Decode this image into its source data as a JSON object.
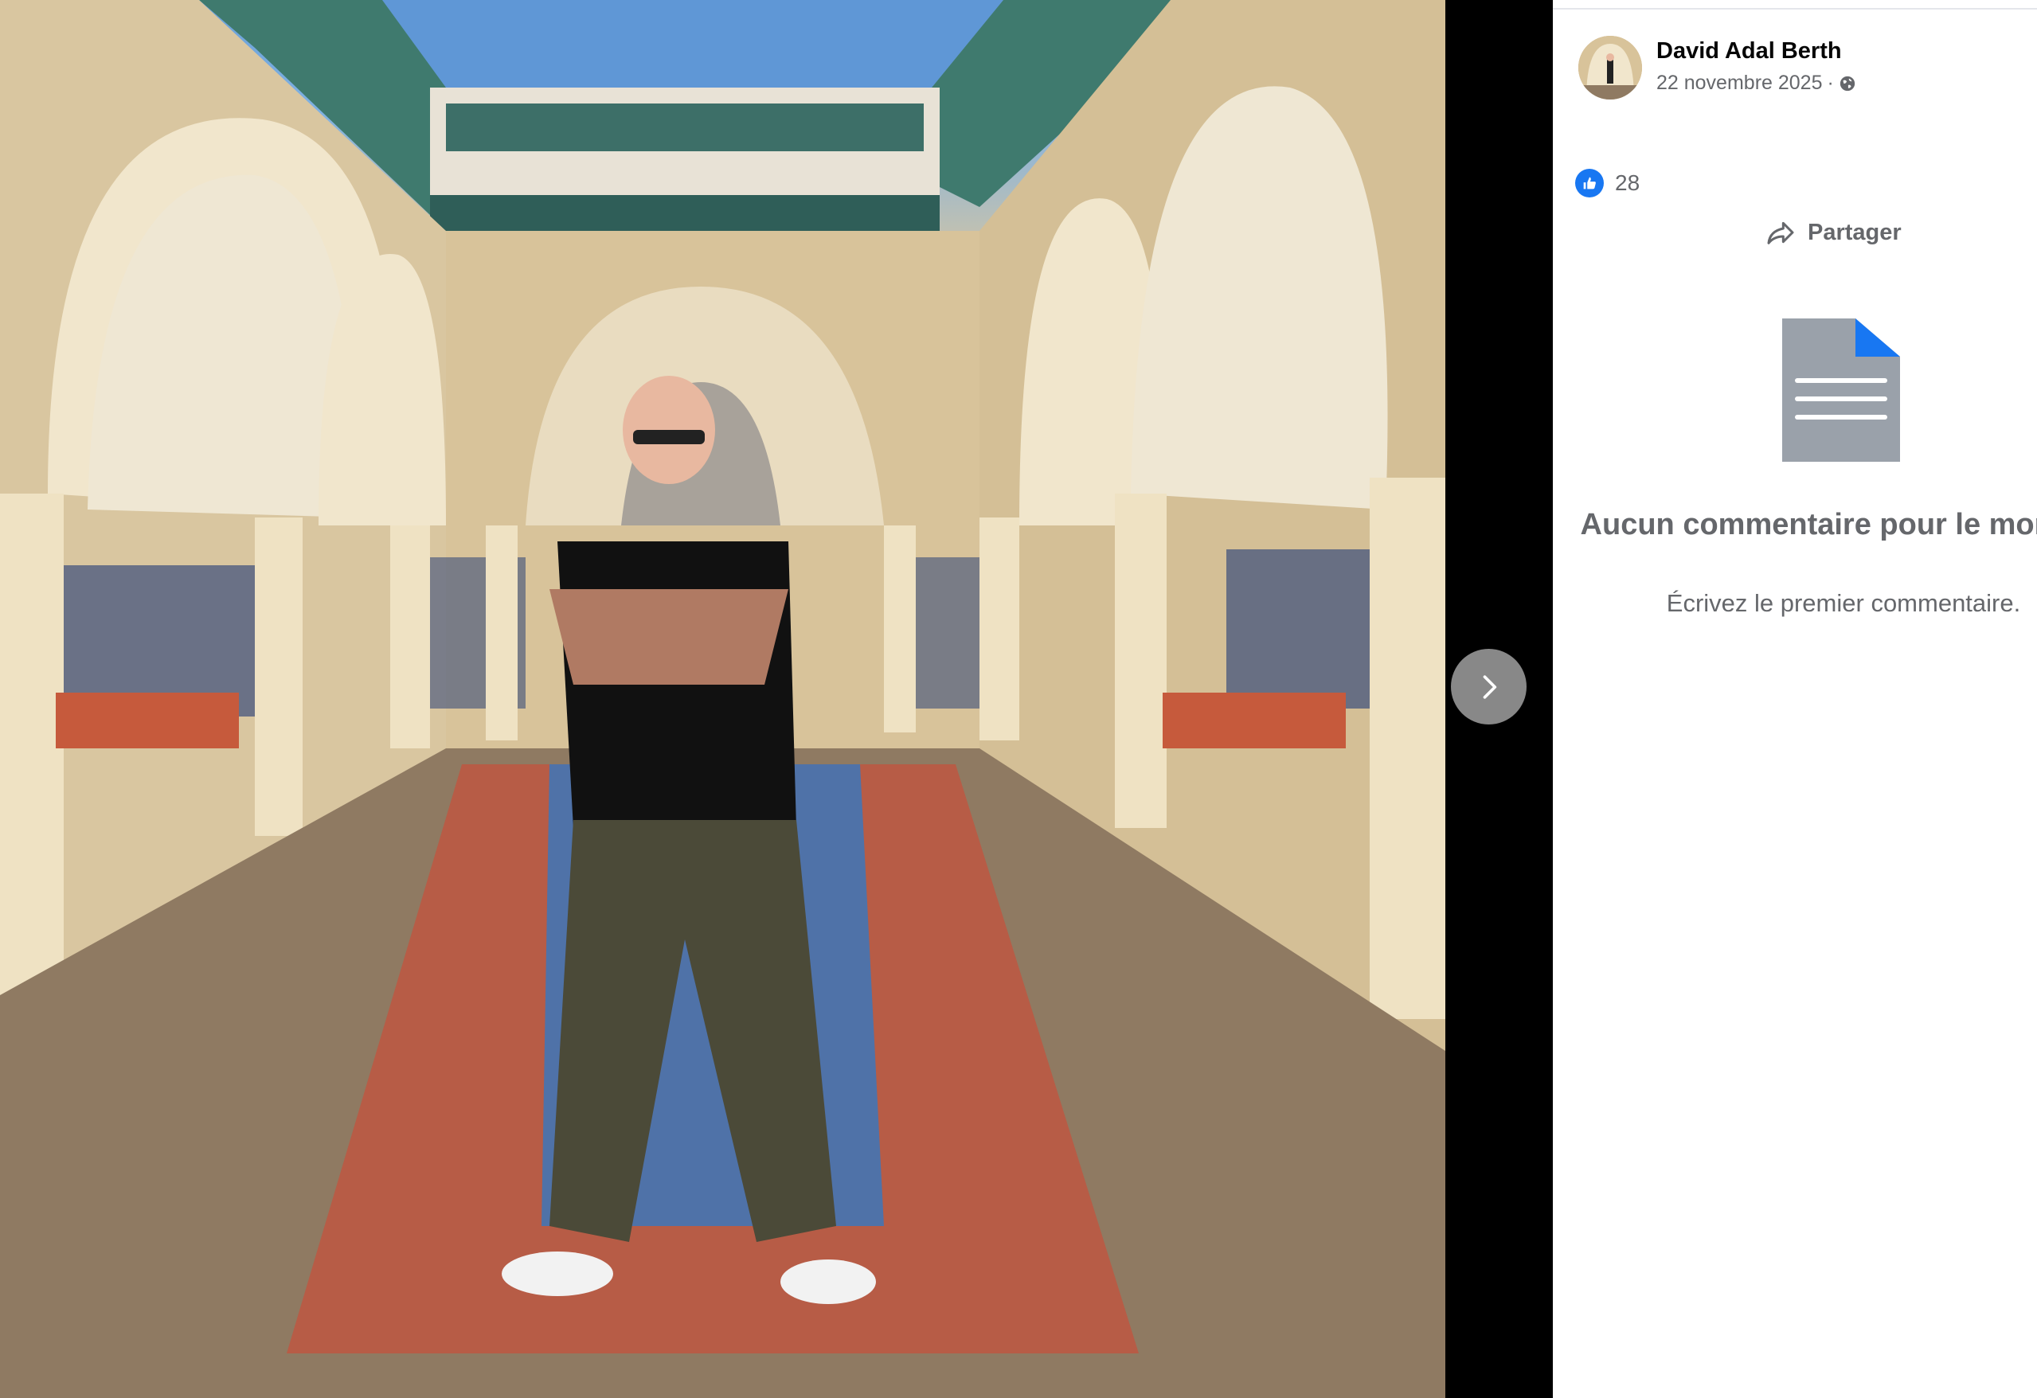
{
  "viewer": {
    "next_button_icon": "chevron-right-icon"
  },
  "post": {
    "author": "David Adal Berth",
    "date": "22 novembre 2025",
    "separator": "·",
    "audience_icon": "globe-icon",
    "like_count": "28",
    "like_icon": "thumbs-up-icon",
    "share_label": "Partager",
    "share_icon": "share-arrow-icon"
  },
  "comments": {
    "empty_icon": "document-icon",
    "empty_title": "Aucun commentaire pour le moment",
    "empty_subtitle": "Écrivez le premier commentaire."
  },
  "colors": {
    "like_blue": "#1877f2",
    "muted_text": "#65676b",
    "doc_gray": "#9aa1aa"
  }
}
